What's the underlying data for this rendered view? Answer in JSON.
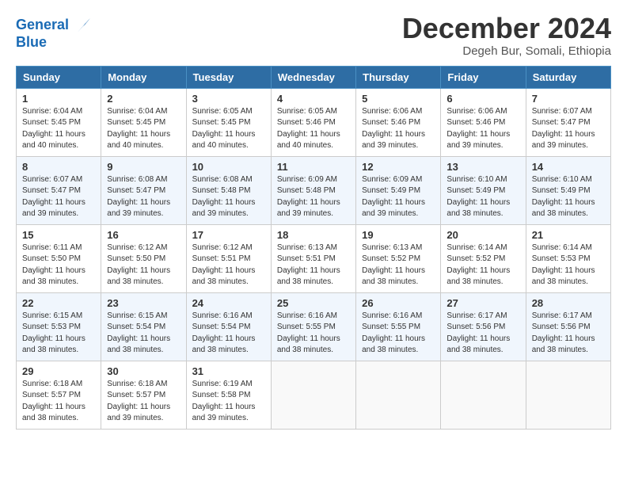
{
  "logo": {
    "line1": "General",
    "line2": "Blue"
  },
  "title": "December 2024",
  "subtitle": "Degeh Bur, Somali, Ethiopia",
  "days_header": [
    "Sunday",
    "Monday",
    "Tuesday",
    "Wednesday",
    "Thursday",
    "Friday",
    "Saturday"
  ],
  "weeks": [
    [
      {
        "day": "1",
        "sunrise": "Sunrise: 6:04 AM",
        "sunset": "Sunset: 5:45 PM",
        "daylight": "Daylight: 11 hours and 40 minutes."
      },
      {
        "day": "2",
        "sunrise": "Sunrise: 6:04 AM",
        "sunset": "Sunset: 5:45 PM",
        "daylight": "Daylight: 11 hours and 40 minutes."
      },
      {
        "day": "3",
        "sunrise": "Sunrise: 6:05 AM",
        "sunset": "Sunset: 5:45 PM",
        "daylight": "Daylight: 11 hours and 40 minutes."
      },
      {
        "day": "4",
        "sunrise": "Sunrise: 6:05 AM",
        "sunset": "Sunset: 5:46 PM",
        "daylight": "Daylight: 11 hours and 40 minutes."
      },
      {
        "day": "5",
        "sunrise": "Sunrise: 6:06 AM",
        "sunset": "Sunset: 5:46 PM",
        "daylight": "Daylight: 11 hours and 39 minutes."
      },
      {
        "day": "6",
        "sunrise": "Sunrise: 6:06 AM",
        "sunset": "Sunset: 5:46 PM",
        "daylight": "Daylight: 11 hours and 39 minutes."
      },
      {
        "day": "7",
        "sunrise": "Sunrise: 6:07 AM",
        "sunset": "Sunset: 5:47 PM",
        "daylight": "Daylight: 11 hours and 39 minutes."
      }
    ],
    [
      {
        "day": "8",
        "sunrise": "Sunrise: 6:07 AM",
        "sunset": "Sunset: 5:47 PM",
        "daylight": "Daylight: 11 hours and 39 minutes."
      },
      {
        "day": "9",
        "sunrise": "Sunrise: 6:08 AM",
        "sunset": "Sunset: 5:47 PM",
        "daylight": "Daylight: 11 hours and 39 minutes."
      },
      {
        "day": "10",
        "sunrise": "Sunrise: 6:08 AM",
        "sunset": "Sunset: 5:48 PM",
        "daylight": "Daylight: 11 hours and 39 minutes."
      },
      {
        "day": "11",
        "sunrise": "Sunrise: 6:09 AM",
        "sunset": "Sunset: 5:48 PM",
        "daylight": "Daylight: 11 hours and 39 minutes."
      },
      {
        "day": "12",
        "sunrise": "Sunrise: 6:09 AM",
        "sunset": "Sunset: 5:49 PM",
        "daylight": "Daylight: 11 hours and 39 minutes."
      },
      {
        "day": "13",
        "sunrise": "Sunrise: 6:10 AM",
        "sunset": "Sunset: 5:49 PM",
        "daylight": "Daylight: 11 hours and 38 minutes."
      },
      {
        "day": "14",
        "sunrise": "Sunrise: 6:10 AM",
        "sunset": "Sunset: 5:49 PM",
        "daylight": "Daylight: 11 hours and 38 minutes."
      }
    ],
    [
      {
        "day": "15",
        "sunrise": "Sunrise: 6:11 AM",
        "sunset": "Sunset: 5:50 PM",
        "daylight": "Daylight: 11 hours and 38 minutes."
      },
      {
        "day": "16",
        "sunrise": "Sunrise: 6:12 AM",
        "sunset": "Sunset: 5:50 PM",
        "daylight": "Daylight: 11 hours and 38 minutes."
      },
      {
        "day": "17",
        "sunrise": "Sunrise: 6:12 AM",
        "sunset": "Sunset: 5:51 PM",
        "daylight": "Daylight: 11 hours and 38 minutes."
      },
      {
        "day": "18",
        "sunrise": "Sunrise: 6:13 AM",
        "sunset": "Sunset: 5:51 PM",
        "daylight": "Daylight: 11 hours and 38 minutes."
      },
      {
        "day": "19",
        "sunrise": "Sunrise: 6:13 AM",
        "sunset": "Sunset: 5:52 PM",
        "daylight": "Daylight: 11 hours and 38 minutes."
      },
      {
        "day": "20",
        "sunrise": "Sunrise: 6:14 AM",
        "sunset": "Sunset: 5:52 PM",
        "daylight": "Daylight: 11 hours and 38 minutes."
      },
      {
        "day": "21",
        "sunrise": "Sunrise: 6:14 AM",
        "sunset": "Sunset: 5:53 PM",
        "daylight": "Daylight: 11 hours and 38 minutes."
      }
    ],
    [
      {
        "day": "22",
        "sunrise": "Sunrise: 6:15 AM",
        "sunset": "Sunset: 5:53 PM",
        "daylight": "Daylight: 11 hours and 38 minutes."
      },
      {
        "day": "23",
        "sunrise": "Sunrise: 6:15 AM",
        "sunset": "Sunset: 5:54 PM",
        "daylight": "Daylight: 11 hours and 38 minutes."
      },
      {
        "day": "24",
        "sunrise": "Sunrise: 6:16 AM",
        "sunset": "Sunset: 5:54 PM",
        "daylight": "Daylight: 11 hours and 38 minutes."
      },
      {
        "day": "25",
        "sunrise": "Sunrise: 6:16 AM",
        "sunset": "Sunset: 5:55 PM",
        "daylight": "Daylight: 11 hours and 38 minutes."
      },
      {
        "day": "26",
        "sunrise": "Sunrise: 6:16 AM",
        "sunset": "Sunset: 5:55 PM",
        "daylight": "Daylight: 11 hours and 38 minutes."
      },
      {
        "day": "27",
        "sunrise": "Sunrise: 6:17 AM",
        "sunset": "Sunset: 5:56 PM",
        "daylight": "Daylight: 11 hours and 38 minutes."
      },
      {
        "day": "28",
        "sunrise": "Sunrise: 6:17 AM",
        "sunset": "Sunset: 5:56 PM",
        "daylight": "Daylight: 11 hours and 38 minutes."
      }
    ],
    [
      {
        "day": "29",
        "sunrise": "Sunrise: 6:18 AM",
        "sunset": "Sunset: 5:57 PM",
        "daylight": "Daylight: 11 hours and 38 minutes."
      },
      {
        "day": "30",
        "sunrise": "Sunrise: 6:18 AM",
        "sunset": "Sunset: 5:57 PM",
        "daylight": "Daylight: 11 hours and 39 minutes."
      },
      {
        "day": "31",
        "sunrise": "Sunrise: 6:19 AM",
        "sunset": "Sunset: 5:58 PM",
        "daylight": "Daylight: 11 hours and 39 minutes."
      },
      null,
      null,
      null,
      null
    ]
  ]
}
